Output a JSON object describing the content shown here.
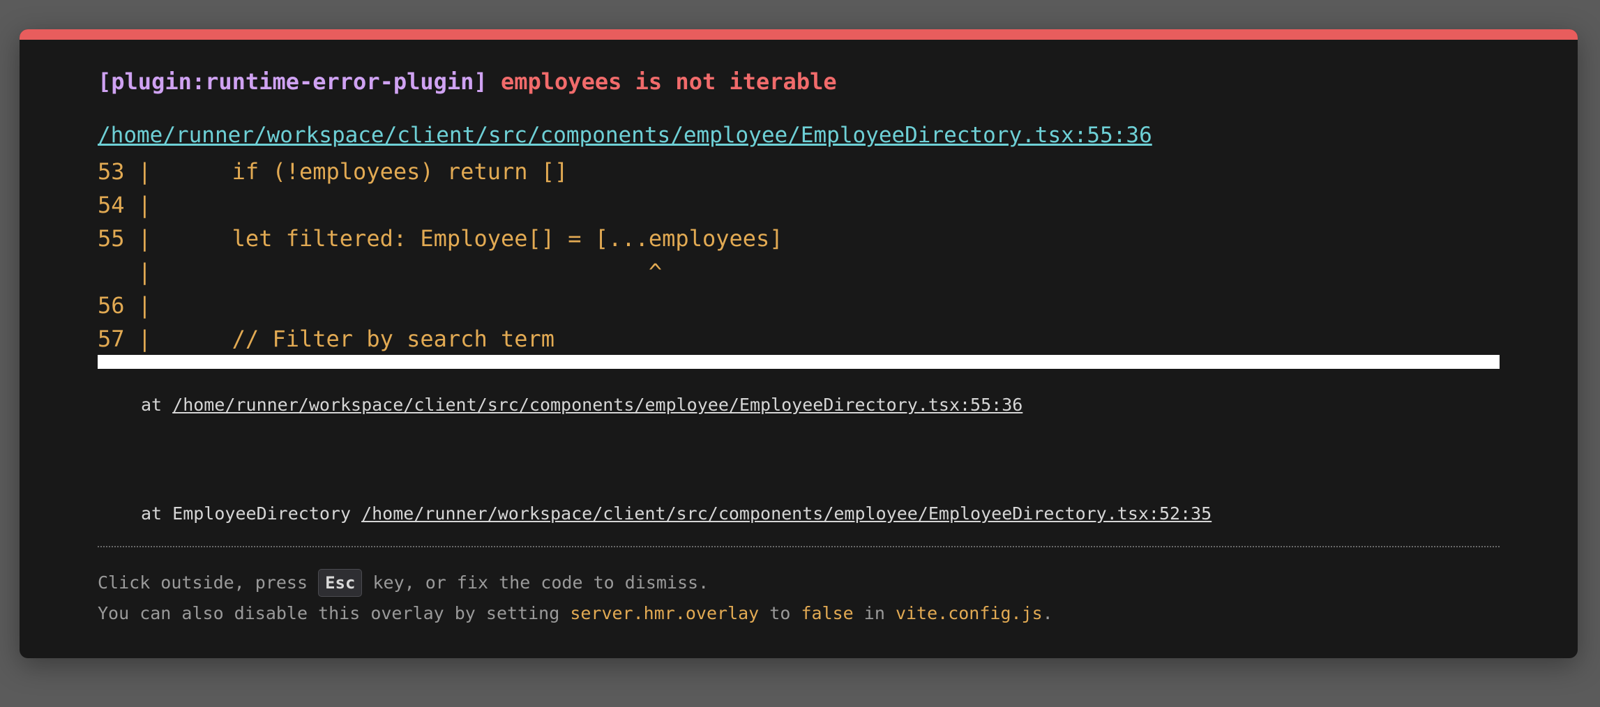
{
  "colors": {
    "backdrop": "#5b5b5b",
    "panel": "#181818",
    "accent_bar": "#e85d5d",
    "plugin": "#cfa2f2",
    "error": "#f16b6b",
    "file_link": "#6ed0d6",
    "code": "#e2aa53",
    "muted": "#9a9a9a"
  },
  "error": {
    "plugin_label": "[plugin:runtime-error-plugin]",
    "message": "employees is not iterable",
    "file": "/home/runner/workspace/client/src/components/employee/EmployeeDirectory.tsx:55:36"
  },
  "frame": {
    "lines": [
      "53 |      if (!employees) return []",
      "54 |",
      "55 |      let filtered: Employee[] = [...employees]",
      "   |                                     ^",
      "56 |",
      "57 |      // Filter by search term"
    ]
  },
  "stack": {
    "entries": [
      {
        "prefix": "at ",
        "link": "/home/runner/workspace/client/src/components/employee/EmployeeDirectory.tsx:55:36"
      },
      {
        "prefix": "at EmployeeDirectory ",
        "link": "/home/runner/workspace/client/src/components/employee/EmployeeDirectory.tsx:52:35"
      }
    ]
  },
  "tip": {
    "line1_before": "Click outside, press ",
    "key": "Esc",
    "line1_after": " key, or fix the code to dismiss.",
    "line2_a": "You can also disable this overlay by setting ",
    "line2_code1": "server.hmr.overlay",
    "line2_b": " to ",
    "line2_code2": "false",
    "line2_c": " in ",
    "line2_code3": "vite.config.js",
    "line2_d": "."
  }
}
